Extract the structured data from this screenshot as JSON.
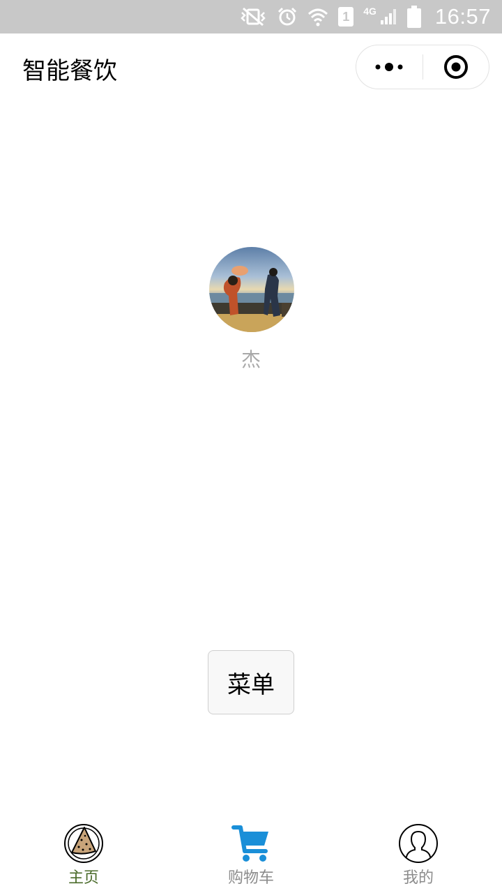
{
  "status_bar": {
    "time": "16:57",
    "sim_slot": "1",
    "network": "4G",
    "icons": [
      "vibrate-icon",
      "alarm-icon",
      "wifi-icon",
      "sim-icon",
      "signal-icon",
      "battery-icon"
    ]
  },
  "nav": {
    "title": "智能餐饮",
    "more_icon": "more-dots-icon",
    "close_icon": "target-close-icon"
  },
  "profile": {
    "username": "杰"
  },
  "main": {
    "menu_button_label": "菜单"
  },
  "tabbar": {
    "active_color": "#4a6b2a",
    "inactive_color": "#8c8c8c",
    "cart_color": "#1a8fd8",
    "tabs": [
      {
        "label": "主页",
        "icon": "pizza-slice-icon",
        "active": true
      },
      {
        "label": "购物车",
        "icon": "shopping-cart-icon",
        "active": false
      },
      {
        "label": "我的",
        "icon": "user-profile-icon",
        "active": false
      }
    ]
  }
}
